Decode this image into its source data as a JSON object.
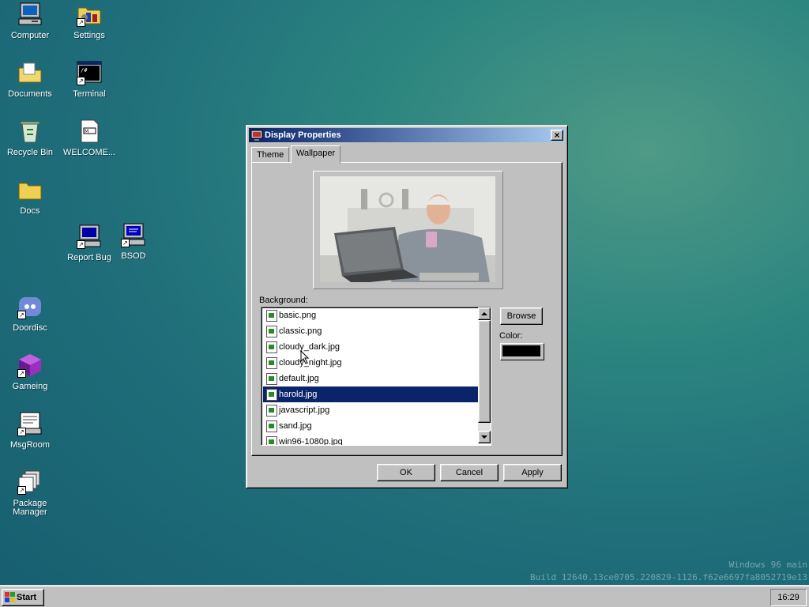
{
  "desktop": {
    "icons": [
      {
        "label": "Computer",
        "icon": "computer-icon"
      },
      {
        "label": "Settings",
        "icon": "settings-folder-icon"
      },
      {
        "label": "Documents",
        "icon": "documents-folder-icon"
      },
      {
        "label": "Terminal",
        "icon": "terminal-icon"
      },
      {
        "label": "Recycle Bin",
        "icon": "recycle-bin-icon"
      },
      {
        "label": "WELCOME...",
        "icon": "welcome-doc-icon"
      },
      {
        "label": "Docs",
        "icon": "folder-icon"
      },
      {
        "label": "Report Bug",
        "icon": "report-bug-icon"
      },
      {
        "label": "BSOD",
        "icon": "bsod-icon"
      },
      {
        "label": "Doordisc",
        "icon": "doordisc-icon"
      },
      {
        "label": "Gameing",
        "icon": "gameing-cube-icon"
      },
      {
        "label": "MsgRoom",
        "icon": "msgroom-icon"
      },
      {
        "label": "Package Manager",
        "icon": "package-manager-icon"
      }
    ],
    "watermark": {
      "line1": "Windows 96 main",
      "line2": "Build 12640.13ce0705.220829-1126.f62e6697fa8052719e13"
    }
  },
  "dialog": {
    "title": "Display Properties",
    "close_label": "×",
    "tabs": [
      {
        "label": "Theme",
        "active": false
      },
      {
        "label": "Wallpaper",
        "active": true
      }
    ],
    "background_label": "Background:",
    "color_label": "Color:",
    "color_value": "#000000",
    "browse_label": "Browse",
    "files": [
      {
        "name": "basic.png",
        "selected": false
      },
      {
        "name": "classic.png",
        "selected": false
      },
      {
        "name": "cloudy_dark.jpg",
        "selected": false
      },
      {
        "name": "cloudy_night.jpg",
        "selected": false
      },
      {
        "name": "default.jpg",
        "selected": false
      },
      {
        "name": "harold.jpg",
        "selected": true
      },
      {
        "name": "javascript.jpg",
        "selected": false
      },
      {
        "name": "sand.jpg",
        "selected": false
      },
      {
        "name": "win96-1080p.jpg",
        "selected": false
      }
    ],
    "buttons": {
      "ok": "OK",
      "cancel": "Cancel",
      "apply": "Apply"
    }
  },
  "taskbar": {
    "start_label": "Start",
    "clock": "16:29"
  },
  "colors": {
    "titlebar_start": "#0a246a",
    "titlebar_end": "#a6caf0",
    "selection": "#0a246a",
    "face": "#c0c0c0"
  }
}
